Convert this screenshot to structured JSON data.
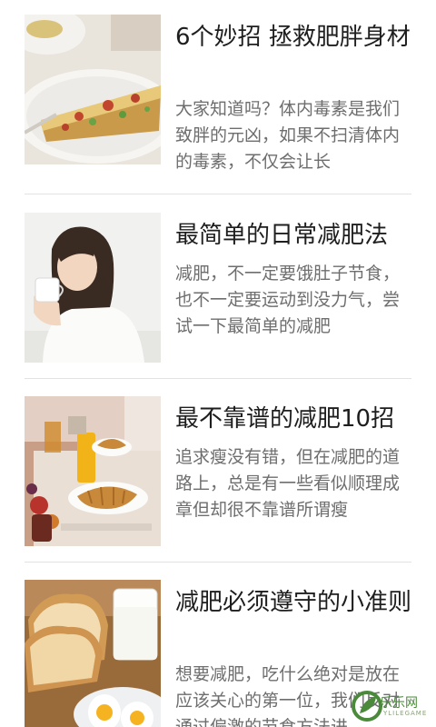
{
  "articles": [
    {
      "title": "6个妙招 拯救肥胖身材",
      "excerpt": "大家知道吗？体内毒素是我们致胖的元凶，如果不扫清体内的毒素，不仅会让长",
      "image": "quiche-slice-photo"
    },
    {
      "title": "最简单的日常减肥法",
      "excerpt": "减肥，不一定要饿肚子节食，也不一定要运动到没力气，尝试一下最简单的减肥",
      "image": "woman-drinking-photo"
    },
    {
      "title": "最不靠谱的减肥10招",
      "excerpt": "追求瘦没有错，但在减肥的道路上，总是有一些看似顺理成章但却很不靠谱所谓瘦",
      "image": "breakfast-table-photo"
    },
    {
      "title": "减肥必须遵守的小准则",
      "excerpt": "想要减肥，吃什么绝对是放在应该关心的第一位，我们反对通过偏激的节食方法进",
      "image": "toast-milk-egg-photo"
    }
  ],
  "watermark": {
    "text": "乐乐网",
    "sub": "YLILEGAME"
  },
  "colors": {
    "background": "#ffffff",
    "title": "#1e1e1e",
    "excerpt": "#6e6e6e",
    "divider": "#e2e2e2"
  }
}
